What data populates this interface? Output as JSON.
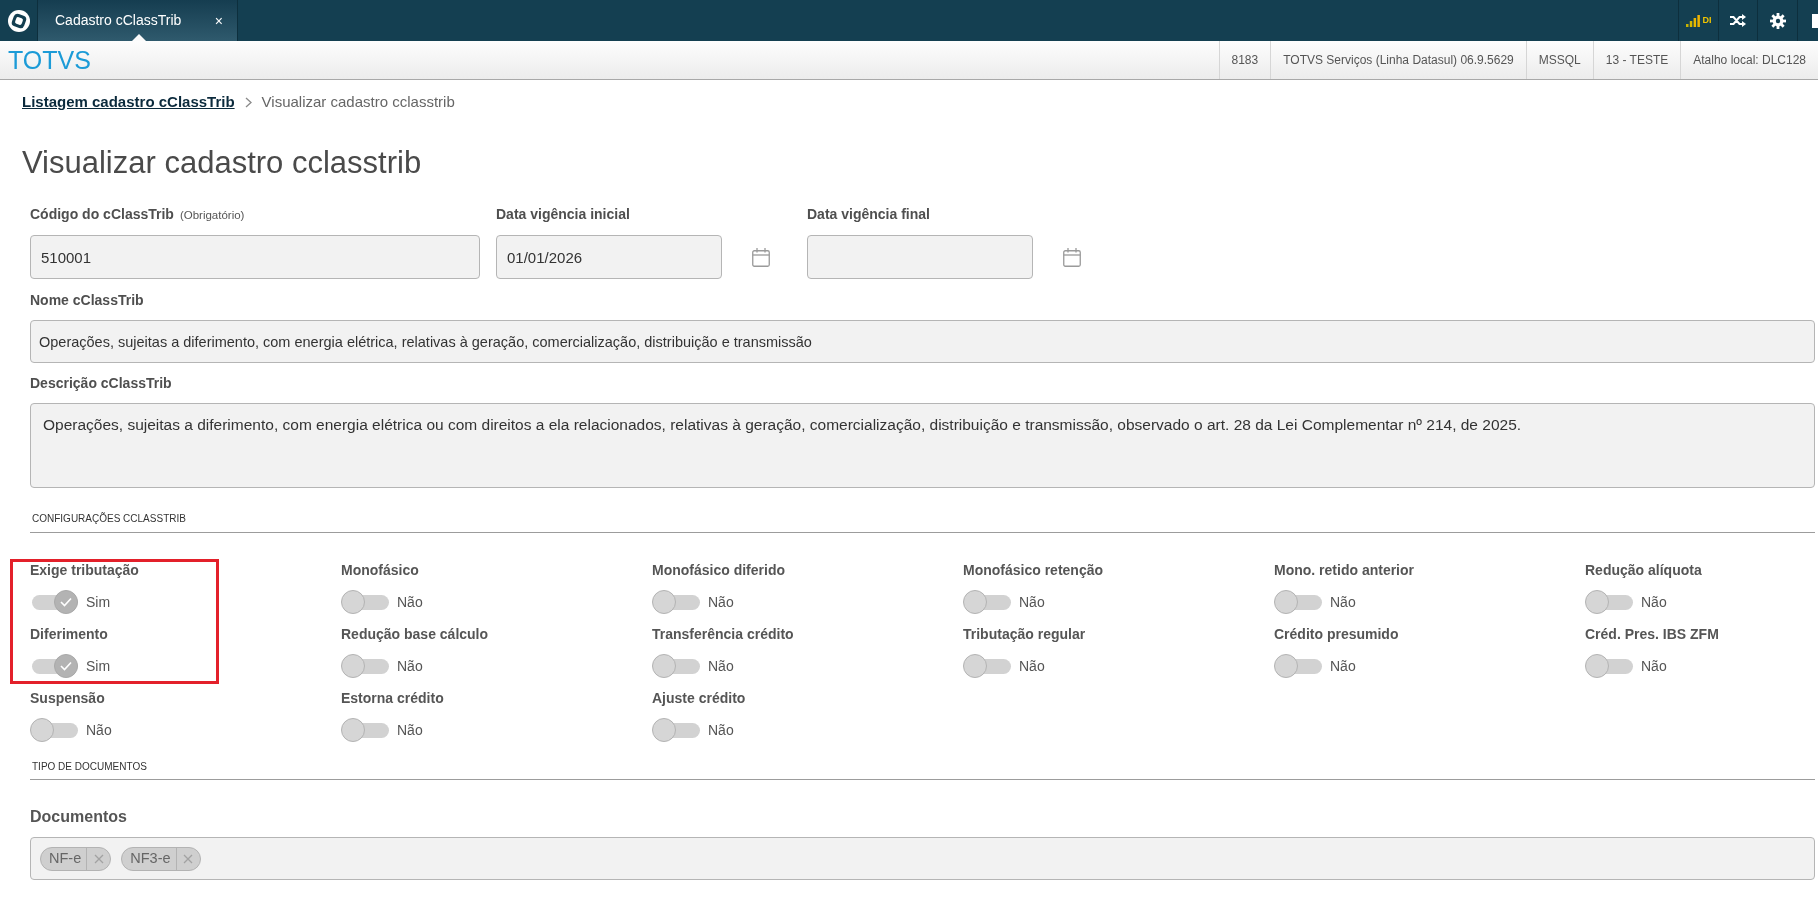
{
  "top_bar": {
    "tab": {
      "label": "Cadastro cClassTrib",
      "close": "×",
      "selected": true
    },
    "status_label": "DI"
  },
  "header": {
    "brand": "TOTVS",
    "info": [
      "8183",
      "TOTVS Serviços (Linha Datasul) 06.9.5629",
      "MSSQL",
      "13 - TESTE",
      "Atalho local: DLC128"
    ]
  },
  "breadcrumb": [
    {
      "kind": "link",
      "label": "Listagem cadastro cClassTrib"
    },
    {
      "kind": "current",
      "label": "Visualizar cadastro cclasstrib"
    }
  ],
  "title": "Visualizar cadastro cclasstrib",
  "key_fields": [
    {
      "kind": "text",
      "label": "Código do cClassTrib",
      "hint": "(Obrigatório)",
      "value": "510001"
    },
    {
      "kind": "date",
      "label": "Data vigência inicial",
      "value": "01/01/2026"
    },
    {
      "kind": "date",
      "label": "Data vigência final"
    }
  ],
  "name_field": {
    "label": "Nome cClassTrib",
    "value": "Operações, sujeitas a diferimento, com energia elétrica, relativas à geração, comercialização, distribuição e transmissão"
  },
  "description_field": {
    "label": "Descrição cClassTrib",
    "value": "Operações, sujeitas a diferimento, com energia elétrica ou com direitos a ela relacionados, relativas à geração, comercialização, distribuição e transmissão, observado o art. 28 da Lei Complementar nº 214, de 2025."
  },
  "configuration": {
    "heading": "CONFIGURAÇÕES CCLASSTRIB",
    "switches": [
      {
        "label": "Exige tributação",
        "on": true,
        "value_label": "Sim",
        "highlighted": true
      },
      {
        "label": "Monofásico",
        "on": false,
        "value_label": "Não",
        "highlighted": false
      },
      {
        "label": "Monofásico diferido",
        "on": false,
        "value_label": "Não",
        "highlighted": false
      },
      {
        "label": "Monofásico retenção",
        "on": false,
        "value_label": "Não",
        "highlighted": false
      },
      {
        "label": "Mono. retido anterior",
        "on": false,
        "value_label": "Não",
        "highlighted": false
      },
      {
        "label": "Redução alíquota",
        "on": false,
        "value_label": "Não",
        "highlighted": false
      },
      {
        "label": "Diferimento",
        "on": true,
        "value_label": "Sim",
        "highlighted": true
      },
      {
        "label": "Redução base cálculo",
        "on": false,
        "value_label": "Não",
        "highlighted": false
      },
      {
        "label": "Transferência crédito",
        "on": false,
        "value_label": "Não",
        "highlighted": false
      },
      {
        "label": "Tributação regular",
        "on": false,
        "value_label": "Não",
        "highlighted": false
      },
      {
        "label": "Crédito presumido",
        "on": false,
        "value_label": "Não",
        "highlighted": false
      },
      {
        "label": "Créd. Pres. IBS ZFM",
        "on": false,
        "value_label": "Não",
        "highlighted": false
      },
      {
        "label": "Suspensão",
        "on": false,
        "value_label": "Não",
        "highlighted": false
      },
      {
        "label": "Estorna crédito",
        "on": false,
        "value_label": "Não",
        "highlighted": false
      },
      {
        "label": "Ajuste crédito",
        "on": false,
        "value_label": "Não",
        "highlighted": false
      }
    ]
  },
  "documents": {
    "heading": "TIPO DE DOCUMENTOS",
    "label": "Documentos",
    "tags": [
      {
        "label": "NF-e"
      },
      {
        "label": "NF3-e"
      }
    ]
  }
}
